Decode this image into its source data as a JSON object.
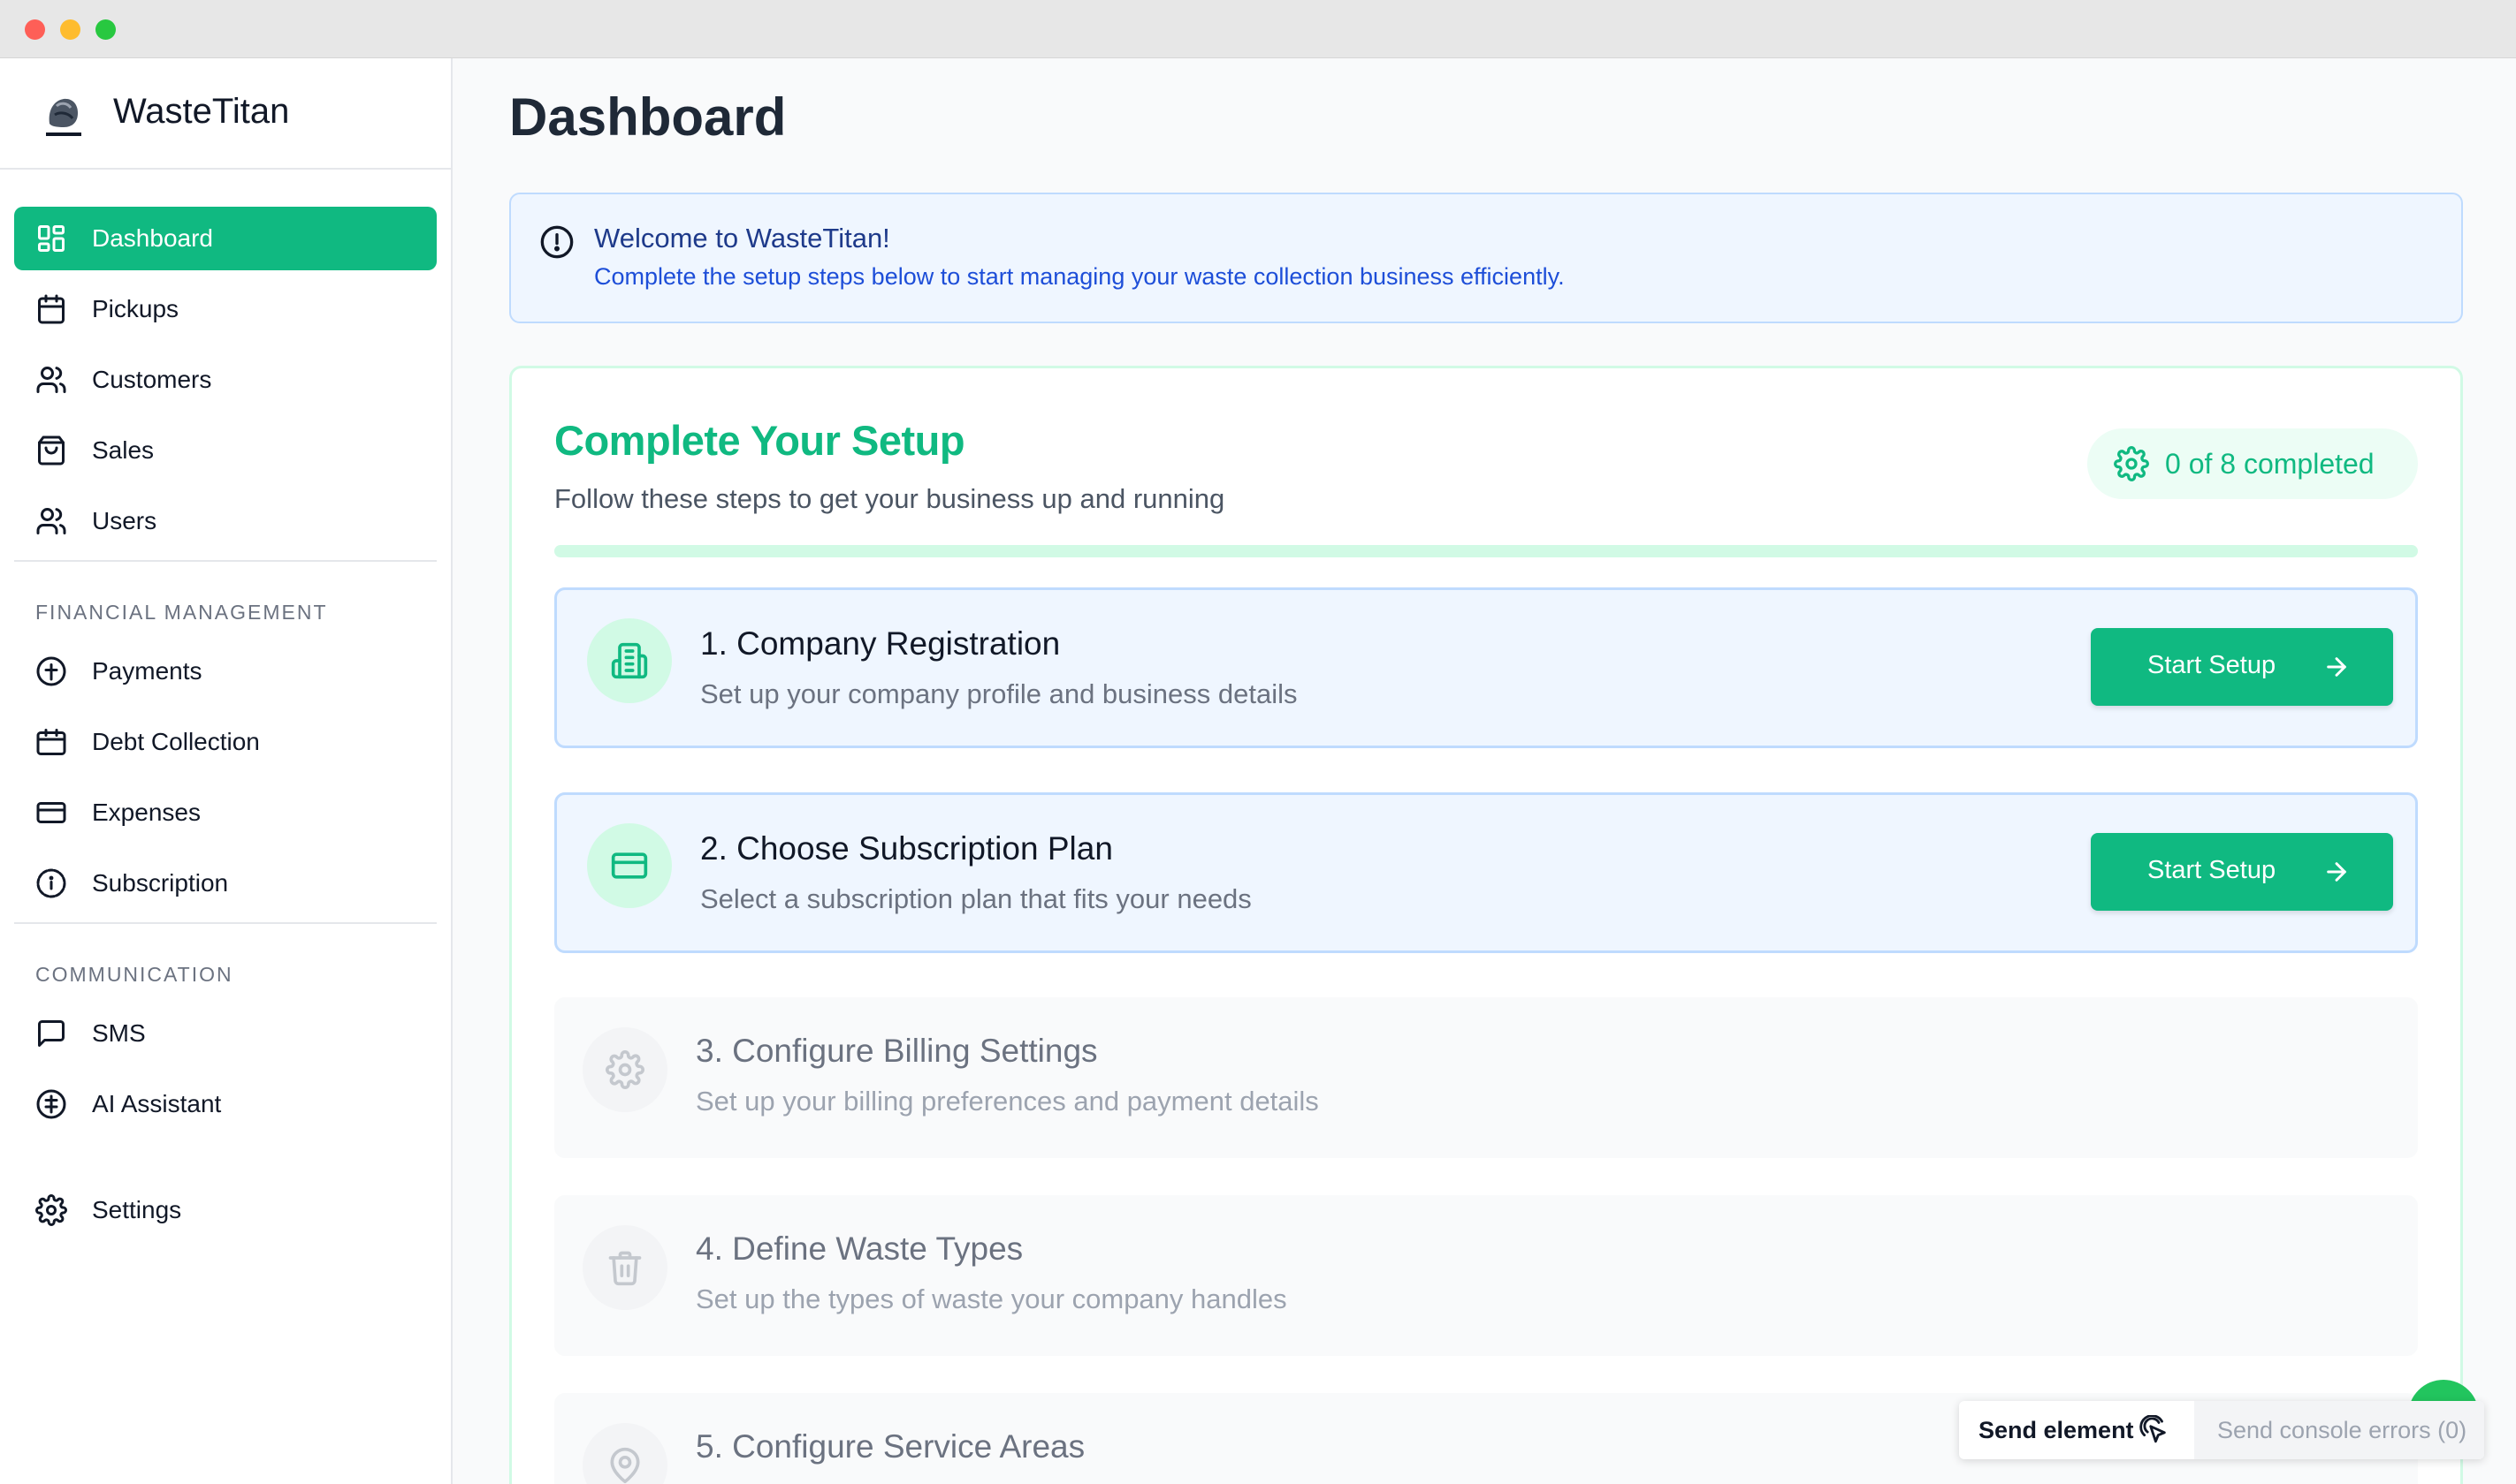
{
  "app": {
    "name": "WasteTitan"
  },
  "sidebar": {
    "items": [
      {
        "label": "Dashboard",
        "icon": "dashboard-grid-icon",
        "active": true
      },
      {
        "label": "Pickups",
        "icon": "calendar-icon"
      },
      {
        "label": "Customers",
        "icon": "users-icon"
      },
      {
        "label": "Sales",
        "icon": "shopping-bag-icon"
      },
      {
        "label": "Users",
        "icon": "users-icon"
      }
    ],
    "sections": [
      {
        "title": "FINANCIAL MANAGEMENT",
        "items": [
          {
            "label": "Payments",
            "icon": "circle-arrow-up-icon"
          },
          {
            "label": "Debt Collection",
            "icon": "calendar-icon"
          },
          {
            "label": "Expenses",
            "icon": "credit-card-icon"
          },
          {
            "label": "Subscription",
            "icon": "info-circle-icon"
          }
        ]
      },
      {
        "title": "COMMUNICATION",
        "items": [
          {
            "label": "SMS",
            "icon": "message-square-icon"
          },
          {
            "label": "AI Assistant",
            "icon": "circle-lines-icon"
          }
        ]
      }
    ],
    "settings": {
      "label": "Settings",
      "icon": "gear-icon"
    }
  },
  "main": {
    "title": "Dashboard",
    "alert": {
      "title": "Welcome to WasteTitan!",
      "text": "Complete the setup steps below to start managing your waste collection business efficiently."
    },
    "setup": {
      "title": "Complete Your Setup",
      "subtitle": "Follow these steps to get your business up and running",
      "progress_label": "0 of 8 completed",
      "progress_fraction": 0,
      "button_label": "Start Setup",
      "steps": [
        {
          "title": "1. Company Registration",
          "description": "Set up your company profile and business details",
          "state": "active",
          "icon": "building-icon"
        },
        {
          "title": "2. Choose Subscription Plan",
          "description": "Select a subscription plan that fits your needs",
          "state": "active",
          "icon": "credit-card-icon"
        },
        {
          "title": "3. Configure Billing Settings",
          "description": "Set up your billing preferences and payment details",
          "state": "disabled",
          "icon": "gear-icon"
        },
        {
          "title": "4. Define Waste Types",
          "description": "Set up the types of waste your company handles",
          "state": "disabled",
          "icon": "trash-icon"
        },
        {
          "title": "5. Configure Service Areas",
          "description": "",
          "state": "disabled",
          "icon": "map-pin-icon"
        }
      ]
    }
  },
  "devtools": {
    "send_element": "Send element",
    "send_console": "Send console errors (0)"
  },
  "colors": {
    "accent": "#10b981",
    "info_bg": "#eff6ff",
    "info_text": "#1d4ed8"
  }
}
